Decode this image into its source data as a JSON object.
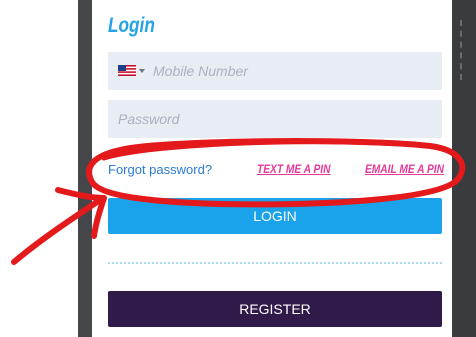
{
  "form": {
    "title": "Login",
    "mobile_placeholder": "Mobile Number",
    "password_placeholder": "Password",
    "forgot_password": "Forgot password?",
    "text_pin": "TEXT ME A PIN",
    "email_pin": "EMAIL ME A PIN",
    "login_label": "LOGIN",
    "register_label": "REGISTER"
  },
  "country": {
    "icon": "us-flag-icon"
  },
  "colors": {
    "title": "#23a3e5",
    "field_bg": "#e8ecf3",
    "link_blue": "#2b7bd4",
    "link_pink": "#e43a9a",
    "login_button": "#1aa3ea",
    "register_button": "#2f1a49",
    "annotation": "#e3191b"
  }
}
